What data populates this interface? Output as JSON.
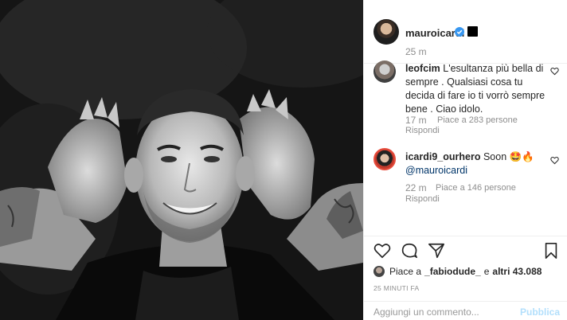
{
  "post": {
    "author": "mauroicardi",
    "time": "25 m",
    "colors": {
      "accent": "#3897f0",
      "publish_disabled": "#b2dffc",
      "muted": "#8e8e8e"
    }
  },
  "comments": [
    {
      "username": "leofcim",
      "text": "L'esultanza più bella di sempre . Qualsiasi cosa tu decida di fare io ti vorrò sempre bene . Ciao idolo.",
      "time": "17 m",
      "likes": "Piace a 283 persone",
      "reply": "Rispondi"
    },
    {
      "username": "icardi9_ourhero",
      "text": "Soon 🤩🔥",
      "mention": "@mauroicardi",
      "time": "22 m",
      "likes": "Piace a 146 persone",
      "reply": "Rispondi"
    }
  ],
  "likes": {
    "prefix": "Piace a",
    "user": "_fabiodude_",
    "suffix": "e",
    "others": "altri 43.088"
  },
  "post_time": "25 MINUTI FA",
  "comment_input": {
    "placeholder": "Aggiungi un commento...",
    "value": ""
  },
  "publish_label": "Pubblica",
  "icons": [
    "verified-icon",
    "heart-icon",
    "comment-icon",
    "share-icon",
    "bookmark-icon"
  ]
}
